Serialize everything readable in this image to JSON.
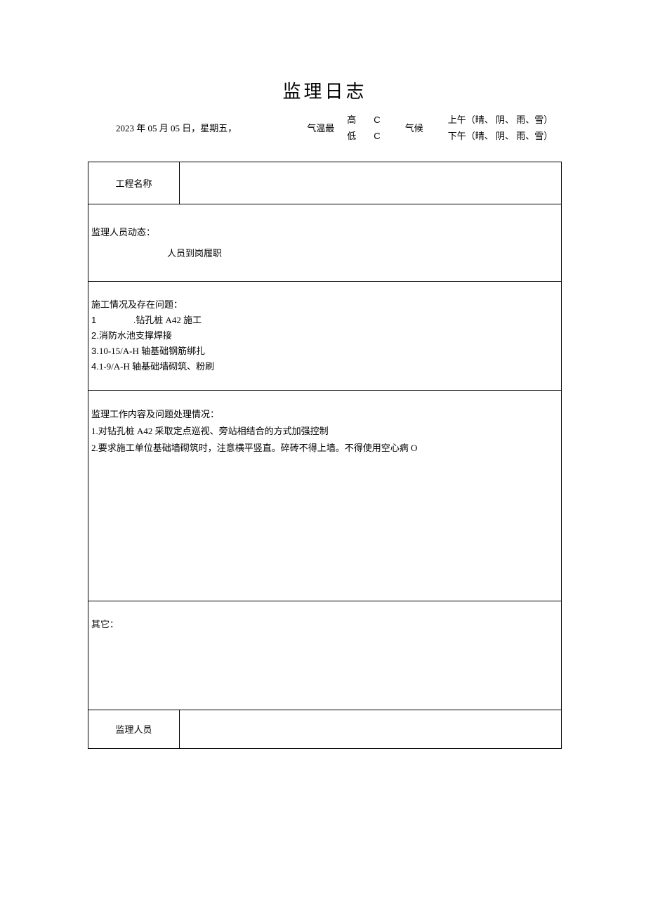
{
  "title": "监理日志",
  "header": {
    "date": "2023 年 05 月 05 日，星期五，",
    "temp_label": "气温最",
    "temp_high": "高",
    "temp_low": "低",
    "temp_unit_high": "C",
    "temp_unit_low": "C",
    "climate_label": "气候",
    "climate_am": "上午（晴、 阴、 雨、雪）",
    "climate_pm": "下午（晴、 阴、 雨、雪）"
  },
  "labels": {
    "project_name": "工程名称",
    "supervisor": "监理人员"
  },
  "sections": {
    "personnel": {
      "heading": "监理人员动态：",
      "body": "人员到岗履职"
    },
    "construction": {
      "heading": "施工情况及存在问题：",
      "items": [
        {
          "num": "1",
          "prefix_wide": true,
          "text": ".钻孔桩 A42 施工"
        },
        {
          "num": "2.",
          "prefix_wide": false,
          "text": "消防水池支撑焊接"
        },
        {
          "num": "3.",
          "prefix_wide": false,
          "text": "10-15/A-H 轴基础钢筋绑扎"
        },
        {
          "num": "4.",
          "prefix_wide": false,
          "text": "1-9/A-H 轴基础墙砌筑、粉刷"
        }
      ]
    },
    "supervision": {
      "heading": "监理工作内容及问题处理情况：",
      "items": [
        "1.对钻孔桩 A42 采取定点巡视、旁站相结合的方式加强控制",
        "2.要求施工单位基础墙砌筑时，注意横平竖直。碎砖不得上墙。不得使用空心病 O"
      ]
    },
    "other": {
      "heading": "其它："
    }
  }
}
